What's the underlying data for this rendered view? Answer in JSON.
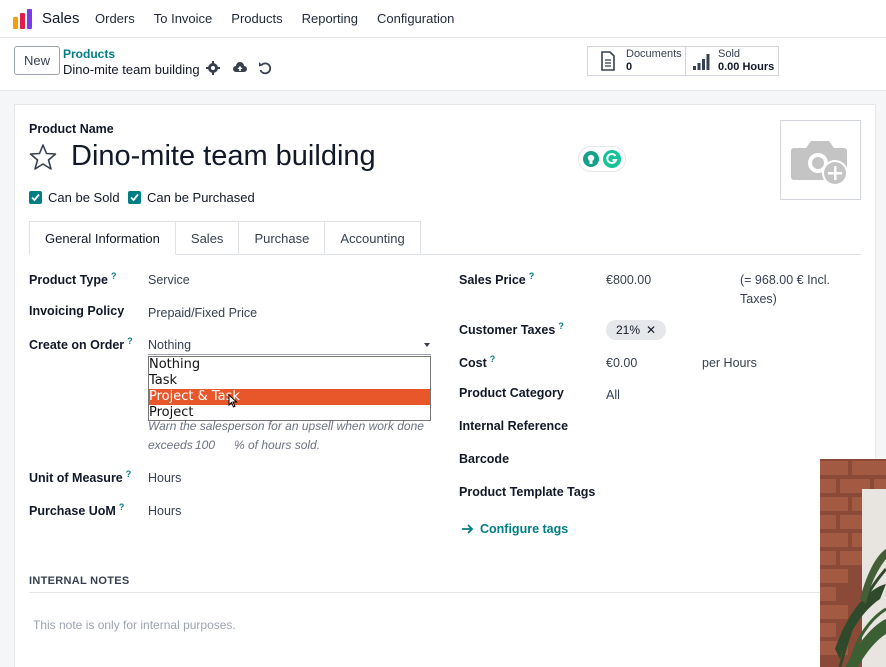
{
  "navbar": {
    "app_name": "Sales",
    "menu": [
      "Orders",
      "To Invoice",
      "Products",
      "Reporting",
      "Configuration"
    ]
  },
  "control": {
    "new_label": "New",
    "breadcrumb_parent": "Products",
    "breadcrumb_current": "Dino-mite team building",
    "documents_label": "Documents",
    "documents_count": "0",
    "sold_label": "Sold",
    "sold_value": "0.00 Hours"
  },
  "form": {
    "product_name_label": "Product Name",
    "product_name": "Dino-mite team building",
    "can_be_sold": "Can be Sold",
    "can_be_purchased": "Can be Purchased",
    "tabs": [
      "General Information",
      "Sales",
      "Purchase",
      "Accounting"
    ],
    "left_fields": {
      "product_type_label": "Product Type",
      "product_type": "Service",
      "invoicing_policy_label": "Invoicing Policy",
      "invoicing_policy": "Prepaid/Fixed Price",
      "create_on_order_label": "Create on Order",
      "create_on_order": "Nothing",
      "create_on_order_options": [
        "Nothing",
        "Task",
        "Project & Task",
        "Project"
      ],
      "upsell_help_1": "Warn the salesperson for an upsell when work done",
      "upsell_exceeds": "exceeds",
      "upsell_value": "100",
      "upsell_help_2": "% of hours sold.",
      "uom_label": "Unit of Measure",
      "uom": "Hours",
      "purchase_uom_label": "Purchase UoM",
      "purchase_uom": "Hours"
    },
    "right_fields": {
      "sales_price_label": "Sales Price",
      "sales_price": "€800.00",
      "incl_taxes_1": "(= 968.00 € Incl.",
      "incl_taxes_2": "Taxes)",
      "customer_taxes_label": "Customer Taxes",
      "customer_tax": "21%",
      "cost_label": "Cost",
      "cost": "€0.00",
      "cost_unit": "per Hours",
      "category_label": "Product Category",
      "category": "All",
      "internal_ref_label": "Internal Reference",
      "barcode_label": "Barcode",
      "template_tags_label": "Product Template Tags",
      "configure_tags": "Configure tags"
    },
    "notes_title": "INTERNAL NOTES",
    "notes_placeholder": "This note is only for internal purposes."
  },
  "colors": {
    "accent": "#017e84",
    "selected_option": "#e8572a"
  }
}
